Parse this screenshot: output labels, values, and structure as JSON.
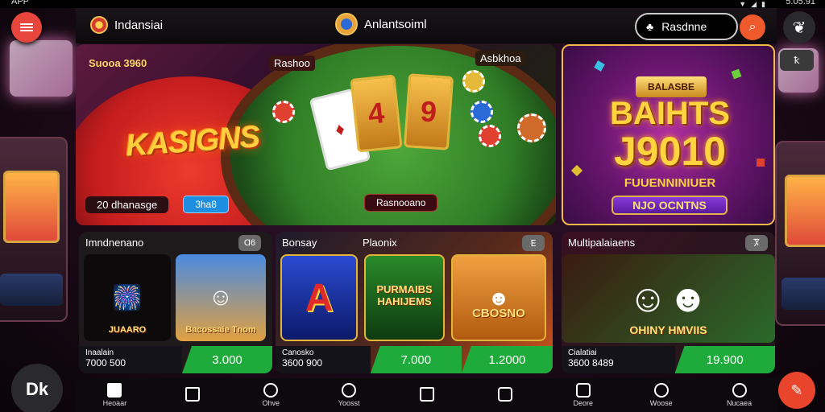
{
  "status": {
    "left": "APP",
    "right": "5:05:91"
  },
  "header": {
    "region": "Indansiai",
    "brand": "Anlantsoiml",
    "search_label": "Rasdnne",
    "profile_icon": "user-group-icon"
  },
  "banner_main": {
    "tag_left": "Suooa 3960",
    "tag_center": "Rashoo",
    "tag_right": "Asbkhoa",
    "logo": "KASIGNS",
    "cards": [
      "4",
      "9",
      "A"
    ],
    "info_left": "20 dhanasge",
    "info_button": "3ha8",
    "center_pill": "Rasnooano"
  },
  "banner_side": {
    "crest": "BALASBE",
    "line1": "BAIHTS",
    "line2": "J9010",
    "subline": "FUUENNINIUER",
    "pill": "NJO OCNTNS",
    "corner_badge": "ꝁ"
  },
  "sections": [
    {
      "title": "Imndnenano",
      "badge": "Ɑ6",
      "tiles": [
        {
          "label": "JUAARO",
          "bg": "#0d0a0c"
        },
        {
          "label": "Bacossaie Tnom",
          "bg": "#3b7ad6"
        }
      ],
      "footer_label": "Inaalain",
      "footer_value": "7000 500",
      "button": "3.000"
    },
    {
      "title": "Bonsay",
      "title2": "Plaonix",
      "badge": "ⴹ",
      "tiles": [
        {
          "label": "A",
          "bg": "#1a3aa0"
        },
        {
          "label": "PURMAIBS HAHIJEMS",
          "bg": "#1e6a22"
        },
        {
          "label": "CBOSNO",
          "bg": "#e3861e"
        }
      ],
      "footer_label": "Canosko",
      "footer_value": "3600 900",
      "button": "7.000",
      "button2": "1.2000"
    },
    {
      "title": "Multipalaiaens",
      "badge": "Ⴟ",
      "tiles": [
        {
          "label": "OHINY HMVIIS",
          "bg": "#2a6a2a"
        }
      ],
      "footer_label": "Cialatiai",
      "footer_value": "3600 8489",
      "button": "19.900"
    }
  ],
  "nav": [
    {
      "label": "Heoaar",
      "icon": "home-icon",
      "active": true
    },
    {
      "label": "",
      "icon": "house-outline-icon"
    },
    {
      "label": "Ohve",
      "icon": "wheel-icon"
    },
    {
      "label": "Yoosst",
      "icon": "swirl-icon"
    },
    {
      "label": "",
      "icon": "house-outline-icon"
    },
    {
      "label": "",
      "icon": "folder-icon"
    },
    {
      "label": "Deore",
      "icon": "card-icon"
    },
    {
      "label": "Woose",
      "icon": "diamond-icon"
    },
    {
      "label": "Nucaea",
      "icon": "search-icon"
    }
  ],
  "fab_left": "Dk",
  "fab_right": "✎",
  "colors": {
    "accent": "#e8453c",
    "green": "#1faa3c",
    "gold": "#ffd43e"
  }
}
